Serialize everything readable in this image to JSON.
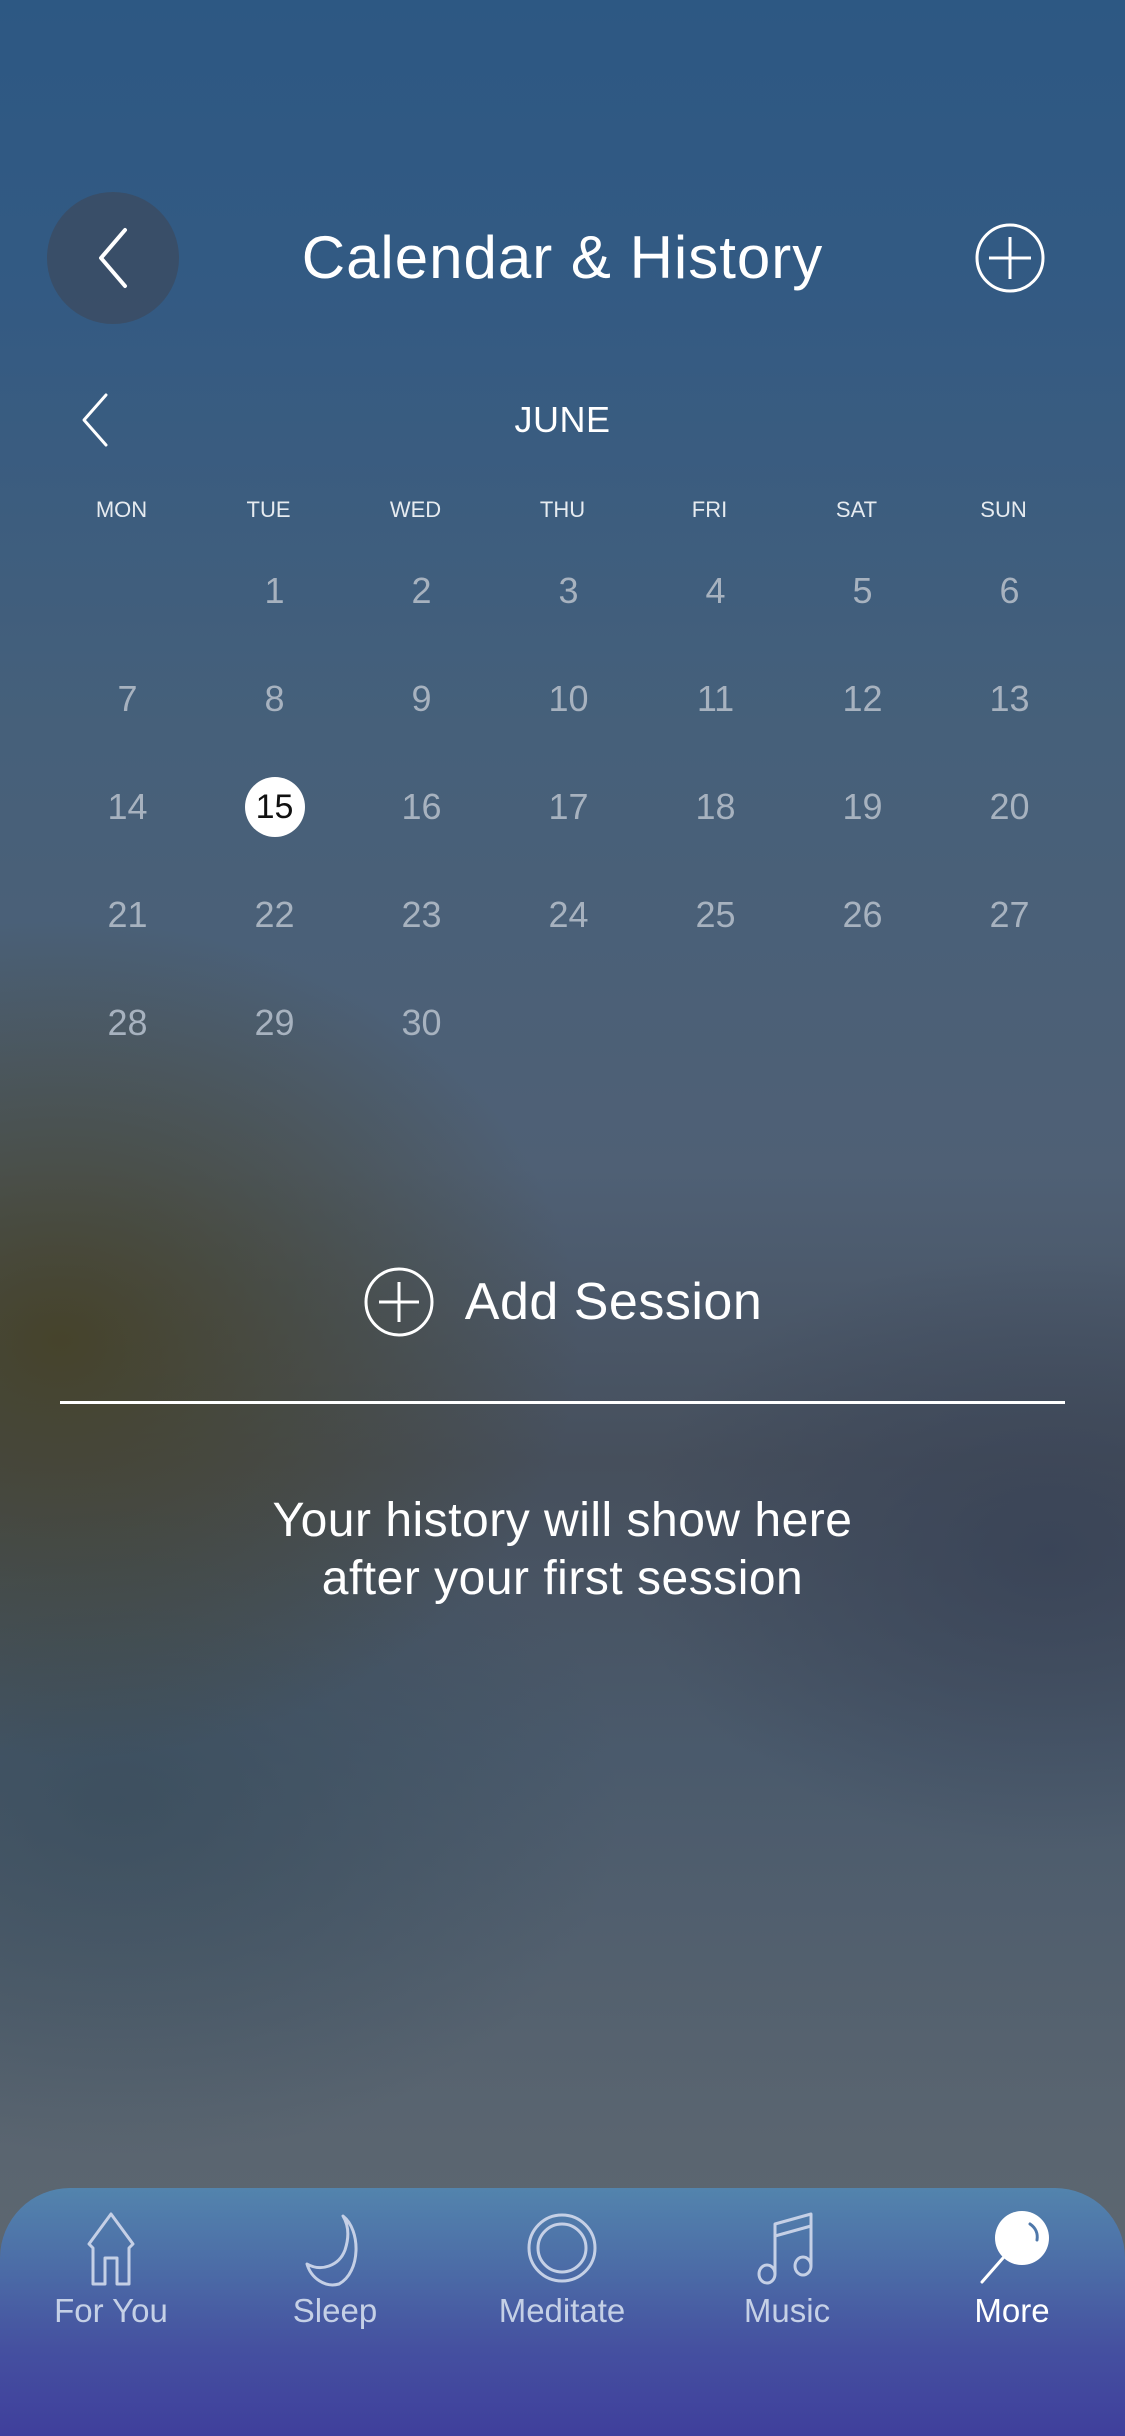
{
  "header": {
    "title": "Calendar & History",
    "back_icon": "chevron-left-icon",
    "add_icon": "plus-circle-icon"
  },
  "calendar": {
    "month": "JUNE",
    "prev_icon": "chevron-left-icon",
    "weekdays": [
      "MON",
      "TUE",
      "WED",
      "THU",
      "FRI",
      "SAT",
      "SUN"
    ],
    "weeks": [
      [
        "",
        "1",
        "2",
        "3",
        "4",
        "5",
        "6"
      ],
      [
        "7",
        "8",
        "9",
        "10",
        "11",
        "12",
        "13"
      ],
      [
        "14",
        "15",
        "16",
        "17",
        "18",
        "19",
        "20"
      ],
      [
        "21",
        "22",
        "23",
        "24",
        "25",
        "26",
        "27"
      ],
      [
        "28",
        "29",
        "30",
        "",
        "",
        "",
        ""
      ]
    ],
    "selected_day": "15"
  },
  "add_session": {
    "label": "Add Session",
    "icon": "plus-circle-icon"
  },
  "empty_state": {
    "line1": "Your history will show here",
    "line2": "after your first session"
  },
  "tabbar": {
    "items": [
      {
        "label": "For You",
        "icon": "home-icon",
        "active": false
      },
      {
        "label": "Sleep",
        "icon": "moon-icon",
        "active": false
      },
      {
        "label": "Meditate",
        "icon": "ring-icon",
        "active": false
      },
      {
        "label": "Music",
        "icon": "music-note-icon",
        "active": false
      },
      {
        "label": "More",
        "icon": "more-icon",
        "active": true
      }
    ]
  },
  "colors": {
    "background_top": "#2d5883",
    "tabbar_top": "#5384ad",
    "tabbar_bottom": "#3f3f9c",
    "day_text": "#a7b2bf",
    "selected_day_bg": "#ffffff"
  }
}
